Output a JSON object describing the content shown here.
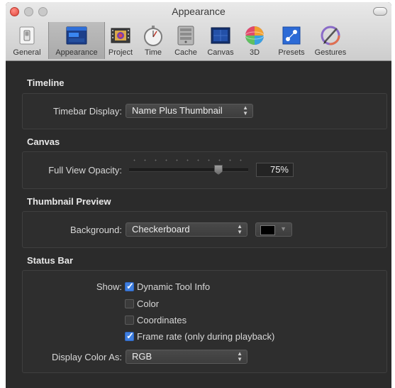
{
  "window": {
    "title": "Appearance"
  },
  "toolbar": {
    "items": [
      {
        "label": "General",
        "icon": "general-switch-icon"
      },
      {
        "label": "Appearance",
        "icon": "appearance-window-icon",
        "selected": true
      },
      {
        "label": "Project",
        "icon": "project-film-icon"
      },
      {
        "label": "Time",
        "icon": "stopwatch-icon"
      },
      {
        "label": "Cache",
        "icon": "cache-drive-icon"
      },
      {
        "label": "Canvas",
        "icon": "canvas-icon"
      },
      {
        "label": "3D",
        "icon": "3d-sphere-icon"
      },
      {
        "label": "Presets",
        "icon": "presets-icon"
      },
      {
        "label": "Gestures",
        "icon": "gestures-pen-icon"
      }
    ]
  },
  "timeline": {
    "title": "Timeline",
    "timebar_label": "Timebar Display:",
    "timebar_value": "Name Plus Thumbnail"
  },
  "canvas": {
    "title": "Canvas",
    "opacity_label": "Full View Opacity:",
    "opacity_value": "75%",
    "opacity_level": 0.75
  },
  "thumbnail": {
    "title": "Thumbnail Preview",
    "background_label": "Background:",
    "background_value": "Checkerboard",
    "color_swatch": "#000000"
  },
  "status_bar": {
    "title": "Status Bar",
    "show_label": "Show:",
    "options": [
      {
        "label": "Dynamic Tool Info",
        "checked": true
      },
      {
        "label": "Color",
        "checked": false
      },
      {
        "label": "Coordinates",
        "checked": false
      },
      {
        "label": "Frame rate (only during playback)",
        "checked": true
      }
    ],
    "display_color_label": "Display Color As:",
    "display_color_value": "RGB"
  },
  "colors": {
    "window_bg": "#2b2b2b",
    "group_bg": "#2e2e2e",
    "accent": "#3f7fe0",
    "close_button": "#e0443a"
  }
}
